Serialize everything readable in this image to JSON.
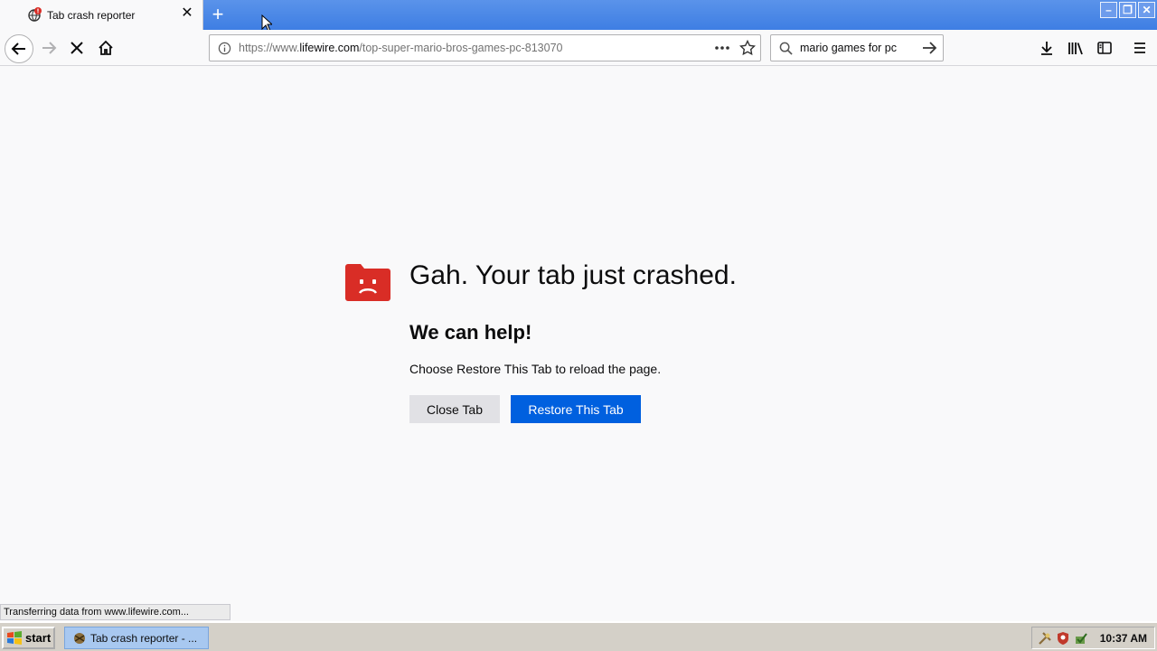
{
  "browser": {
    "tab": {
      "title": "Tab crash reporter",
      "close_glyph": "✕"
    },
    "new_tab_glyph": "+",
    "window_controls": {
      "minimize": "–",
      "restore": "❐",
      "close": "✕"
    },
    "url": {
      "prefix": "https://www.",
      "domain": "lifewire.com",
      "path": "/top-super-mario-bros-games-pc-813070"
    },
    "search_value": "mario games for pc"
  },
  "crash_page": {
    "title": "Gah. Your tab just crashed.",
    "subtitle": "We can help!",
    "description": "Choose Restore This Tab to reload the page.",
    "close_tab_label": "Close Tab",
    "restore_tab_label": "Restore This Tab",
    "icon": "sad-tab-icon",
    "accent_color": "#d92d26",
    "button_color": "#0060df"
  },
  "status": {
    "text": "Transferring data from www.lifewire.com..."
  },
  "taskbar": {
    "start_label": "start",
    "task_label": "Tab crash reporter - ...",
    "clock": "10:37 AM"
  }
}
